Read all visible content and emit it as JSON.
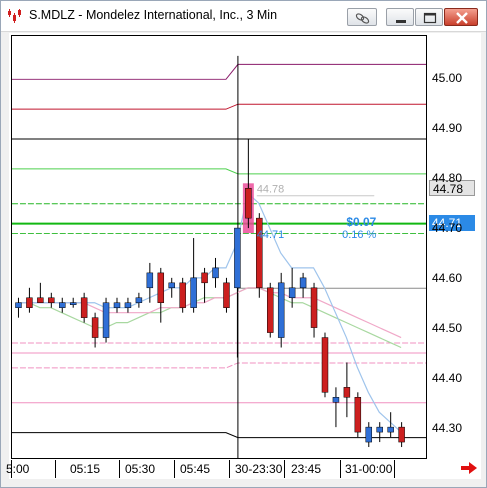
{
  "window": {
    "title": "S.MDLZ - Mondelez International, Inc., 3 Min"
  },
  "icons": {
    "app": "chart-app-icon",
    "link": "link-icon",
    "minimize": "minimize-icon",
    "restore": "restore-icon",
    "close": "close-icon",
    "scroll_right": "right-arrow-icon"
  },
  "colors": {
    "up_candle": "#2f6fd6",
    "down_candle": "#cc1f1f",
    "wick": "#000000",
    "highlight": "#ec4f9b",
    "current_price_bg": "#2b8ae6",
    "blue_label": "#2b8ae6"
  },
  "annotations": {
    "grey_price": "44.78",
    "green_price": "44.71",
    "change": "$0.07",
    "change_pct": "0.16 %"
  },
  "price_boxes": {
    "last": "44.78",
    "current": "44.71"
  },
  "chart_data": {
    "type": "candlestick",
    "title": "S.MDLZ - Mondelez International, Inc., 3 Min",
    "ylim": [
      44.22,
      45.09
    ],
    "y_ticks": [
      "45.00",
      "44.90",
      "44.80",
      "44.70",
      "44.60",
      "44.50",
      "44.40",
      "44.30"
    ],
    "x_ticks": [
      "5:00",
      "05:15",
      "05:30",
      "05:45",
      "30-23:30",
      "23:45",
      "31-00:00"
    ],
    "candles": [
      {
        "open": 44.54,
        "high": 44.56,
        "low": 44.52,
        "close": 44.55
      },
      {
        "open": 44.56,
        "high": 44.58,
        "low": 44.53,
        "close": 44.54
      },
      {
        "open": 44.56,
        "high": 44.59,
        "low": 44.55,
        "close": 44.55
      },
      {
        "open": 44.56,
        "high": 44.57,
        "low": 44.54,
        "close": 44.55
      },
      {
        "open": 44.54,
        "high": 44.56,
        "low": 44.53,
        "close": 44.55
      },
      {
        "open": 44.55,
        "high": 44.56,
        "low": 44.54,
        "close": 44.55
      },
      {
        "open": 44.56,
        "high": 44.57,
        "low": 44.51,
        "close": 44.52
      },
      {
        "open": 44.52,
        "high": 44.53,
        "low": 44.46,
        "close": 44.48
      },
      {
        "open": 44.48,
        "high": 44.56,
        "low": 44.47,
        "close": 44.55
      },
      {
        "open": 44.54,
        "high": 44.56,
        "low": 44.53,
        "close": 44.55
      },
      {
        "open": 44.54,
        "high": 44.56,
        "low": 44.53,
        "close": 44.55
      },
      {
        "open": 44.55,
        "high": 44.57,
        "low": 44.54,
        "close": 44.56
      },
      {
        "open": 44.58,
        "high": 44.63,
        "low": 44.55,
        "close": 44.61
      },
      {
        "open": 44.61,
        "high": 44.62,
        "low": 44.51,
        "close": 44.55
      },
      {
        "open": 44.58,
        "high": 44.6,
        "low": 44.56,
        "close": 44.59
      },
      {
        "open": 44.59,
        "high": 44.6,
        "low": 44.53,
        "close": 44.54
      },
      {
        "open": 44.54,
        "high": 44.68,
        "low": 44.53,
        "close": 44.6
      },
      {
        "open": 44.61,
        "high": 44.62,
        "low": 44.55,
        "close": 44.59
      },
      {
        "open": 44.6,
        "high": 44.64,
        "low": 44.58,
        "close": 44.62
      },
      {
        "open": 44.59,
        "high": 44.6,
        "low": 44.53,
        "close": 44.54
      },
      {
        "open": 44.58,
        "high": 44.7,
        "low": 44.44,
        "close": 44.7
      },
      {
        "open": 44.78,
        "high": 44.88,
        "low": 44.7,
        "close": 44.72
      },
      {
        "open": 44.72,
        "high": 44.73,
        "low": 44.56,
        "close": 44.58
      },
      {
        "open": 44.58,
        "high": 44.59,
        "low": 44.48,
        "close": 44.49
      },
      {
        "open": 44.48,
        "high": 44.61,
        "low": 44.46,
        "close": 44.59
      },
      {
        "open": 44.56,
        "high": 44.62,
        "low": 44.54,
        "close": 44.58
      },
      {
        "open": 44.58,
        "high": 44.61,
        "low": 44.56,
        "close": 44.6
      },
      {
        "open": 44.58,
        "high": 44.59,
        "low": 44.48,
        "close": 44.5
      },
      {
        "open": 44.48,
        "high": 44.49,
        "low": 44.36,
        "close": 44.37
      },
      {
        "open": 44.35,
        "high": 44.38,
        "low": 44.3,
        "close": 44.36
      },
      {
        "open": 44.38,
        "high": 44.43,
        "low": 44.32,
        "close": 44.36
      },
      {
        "open": 44.36,
        "high": 44.37,
        "low": 44.28,
        "close": 44.29
      },
      {
        "open": 44.27,
        "high": 44.31,
        "low": 44.26,
        "close": 44.3
      },
      {
        "open": 44.29,
        "high": 44.31,
        "low": 44.27,
        "close": 44.3
      },
      {
        "open": 44.29,
        "high": 44.33,
        "low": 44.28,
        "close": 44.3
      },
      {
        "open": 44.3,
        "high": 44.31,
        "low": 44.26,
        "close": 44.27
      }
    ],
    "levels": [
      {
        "before": 45.0,
        "after": 45.03,
        "color": "#8a1a6a"
      },
      {
        "before": 44.94,
        "after": 44.95,
        "color": "#c0162e"
      },
      {
        "before": 44.88,
        "after": 44.88,
        "color": "#000000"
      },
      {
        "before": 44.82,
        "after": 44.81,
        "color": "#4dd04d"
      },
      {
        "before": 44.75,
        "after": 44.75,
        "color": "#24b624",
        "dash": true
      },
      {
        "before": 44.71,
        "after": 44.71,
        "color": "#12b812",
        "thick": true
      },
      {
        "before": 44.69,
        "after": 44.69,
        "color": "#24b624",
        "dash": true
      },
      {
        "before": 44.47,
        "after": 44.47,
        "color": "#f090c0",
        "dash": true
      },
      {
        "before": 44.45,
        "after": 44.45,
        "color": "#f090c0"
      },
      {
        "before": 44.42,
        "after": 44.43,
        "color": "#f090c0",
        "dash": true
      },
      {
        "before": 44.35,
        "after": 44.35,
        "color": "#f090c0"
      },
      {
        "before": 44.29,
        "after": 44.28,
        "color": "#000000"
      }
    ],
    "mid_line": {
      "value": 44.58,
      "color": "#8a8a8a"
    },
    "indicator_blue": [
      44.55,
      44.55,
      44.55,
      44.55,
      44.55,
      44.55,
      44.55,
      44.55,
      44.54,
      44.54,
      44.54,
      44.55,
      44.56,
      44.57,
      44.58,
      44.58,
      44.6,
      44.6,
      44.62,
      44.62,
      44.67,
      44.77,
      44.75,
      44.7,
      44.65,
      44.62,
      44.62,
      44.62,
      44.58,
      44.53,
      44.48,
      44.42,
      44.37,
      44.33,
      44.31,
      44.29
    ],
    "indicator_pink": [
      44.55,
      44.55,
      44.55,
      44.55,
      44.55,
      44.55,
      44.55,
      44.54,
      44.53,
      44.53,
      44.53,
      44.53,
      44.53,
      44.54,
      44.54,
      44.54,
      44.55,
      44.55,
      44.56,
      44.56,
      44.57,
      44.58,
      44.58,
      44.57,
      44.57,
      44.56,
      44.56,
      44.56,
      44.55,
      44.54,
      44.53,
      44.52,
      44.51,
      44.5,
      44.49,
      44.48
    ],
    "indicator_green": [
      44.55,
      44.55,
      44.54,
      44.54,
      44.53,
      44.52,
      44.51,
      44.5,
      44.5,
      44.51,
      44.51,
      44.52,
      44.53,
      44.53,
      44.54,
      44.54,
      44.55,
      44.56,
      44.56,
      44.56,
      44.57,
      44.58,
      44.58,
      44.57,
      44.56,
      44.55,
      44.55,
      44.54,
      44.53,
      44.52,
      44.51,
      44.5,
      44.49,
      44.48,
      44.47,
      44.46
    ]
  }
}
